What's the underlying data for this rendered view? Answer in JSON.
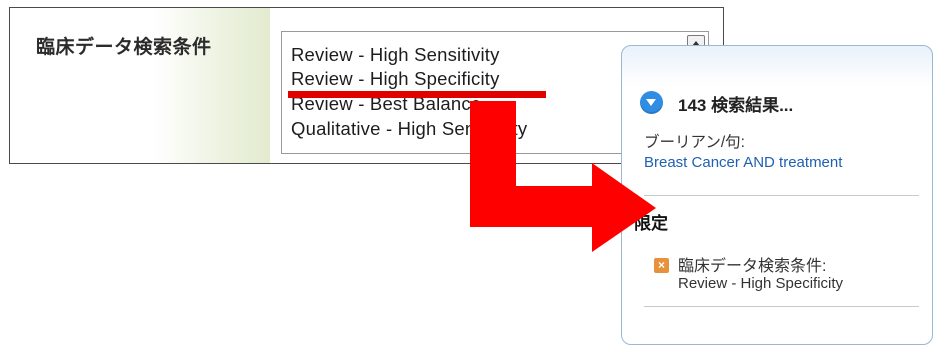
{
  "filter": {
    "label": "臨床データ検索条件",
    "options": [
      "Review - High Sensitivity",
      "Review - High Specificity",
      "Review - Best Balance",
      "Qualitative - High Sensitivity"
    ],
    "selected": "Review - High Specificity"
  },
  "results": {
    "count_text": "143 検索結果...",
    "boolean_label": "ブーリアン/句:",
    "boolean_query": "Breast Cancer AND treatment",
    "limit_header": "限定",
    "remove_icon_glyph": "×",
    "limit_name": "臨床データ検索条件:",
    "limit_value": "Review - High Specificity"
  },
  "colors": {
    "arrow": "#ff0000",
    "underline": "#e00000",
    "link": "#1f5fb4",
    "count_icon": "#2f8de4",
    "remove_icon": "#e8913b"
  }
}
